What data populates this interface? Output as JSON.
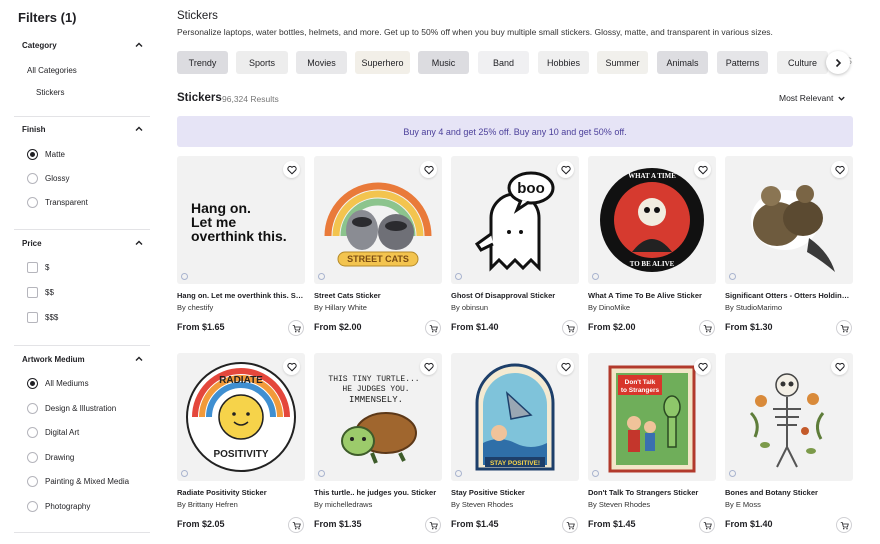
{
  "filters": {
    "title": "Filters (1)",
    "category": {
      "heading": "Category",
      "all": "All Categories",
      "current": "Stickers"
    },
    "finish": {
      "heading": "Finish",
      "options": [
        "Matte",
        "Glossy",
        "Transparent"
      ],
      "selected": "Matte"
    },
    "price": {
      "heading": "Price",
      "options": [
        "$",
        "$$",
        "$$$"
      ]
    },
    "medium": {
      "heading": "Artwork Medium",
      "options": [
        "All Mediums",
        "Design & Illustration",
        "Digital Art",
        "Drawing",
        "Painting & Mixed Media",
        "Photography"
      ],
      "selected": "All Mediums"
    }
  },
  "header": {
    "title": "Stickers",
    "description": "Personalize laptops, water bottles, helmets, and more. Get up to 50% off when you buy multiple small stickers. Glossy, matte, and transparent in various sizes."
  },
  "tags": [
    "Trendy",
    "Sports",
    "Movies",
    "Superhero",
    "Music",
    "Band",
    "Hobbies",
    "Summer",
    "Animals",
    "Patterns",
    "Culture"
  ],
  "tag_overflow": "S",
  "results": {
    "title": "Stickers",
    "count": "96,324 Results",
    "sort": "Most Relevant"
  },
  "promo": "Buy any 4 and get 25% off.  Buy any 10 and get 50% off.",
  "products": [
    {
      "title": "Hang on. Let me overthink this. Sticker",
      "artist": "By chestify",
      "price": "From $1.65",
      "art_text": "Hang on.\nLet me\noverthink this."
    },
    {
      "title": "Street Cats Sticker",
      "artist": "By Hillary White",
      "price": "From $2.00",
      "art_text": "STREET CATS"
    },
    {
      "title": "Ghost Of Disapproval Sticker",
      "artist": "By obinsun",
      "price": "From $1.40",
      "art_text": "boo"
    },
    {
      "title": "What A Time To Be Alive Sticker",
      "artist": "By DinoMike",
      "price": "From $2.00",
      "art_text": "WHAT A TIME TO BE ALIVE"
    },
    {
      "title": "Significant Otters - Otters Holding Hands Sticker",
      "artist": "By StudioMarimo",
      "price": "From $1.30",
      "art_text": ""
    },
    {
      "title": "Radiate Positivity Sticker",
      "artist": "By Brittany Hefren",
      "price": "From $2.05",
      "art_text": "RADIATE POSITIVITY"
    },
    {
      "title": "This turtle.. he judges you. Sticker",
      "artist": "By michelledraws",
      "price": "From $1.35",
      "art_text": "THIS TINY TURTLE... HE JUDGES YOU. IMMENSELY."
    },
    {
      "title": "Stay Positive Sticker",
      "artist": "By Steven Rhodes",
      "price": "From $1.45",
      "art_text": "STAY POSITIVE!"
    },
    {
      "title": "Don't Talk To Strangers Sticker",
      "artist": "By Steven Rhodes",
      "price": "From $1.45",
      "art_text": "Don't Talk to Strangers"
    },
    {
      "title": "Bones and Botany Sticker",
      "artist": "By E Moss",
      "price": "From $1.40",
      "art_text": ""
    }
  ],
  "colors": {
    "tag_bg": "#f2f2f4",
    "tag_bg_dark": "#dcdce0",
    "promo_bg": "#e6e4f6",
    "promo_text": "#4b3f9a",
    "card_bg": "#f2f2f2"
  }
}
